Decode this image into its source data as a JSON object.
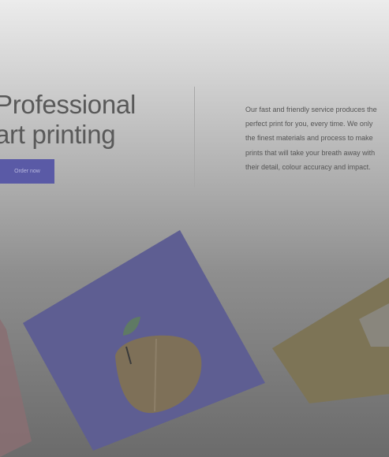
{
  "hero": {
    "title_line1": "Professional",
    "title_line2": "art printing",
    "cta_label": "Order now"
  },
  "intro": {
    "lines": [
      "Our fast and friendly service produces the",
      "perfect print for you, every time. We only",
      "the finest materials and process to make",
      "prints that will take your breath away with",
      "their detail, colour accuracy and impact."
    ]
  },
  "colors": {
    "accent": "#5a5aa6",
    "title": "#595959",
    "body_text": "#555555"
  }
}
